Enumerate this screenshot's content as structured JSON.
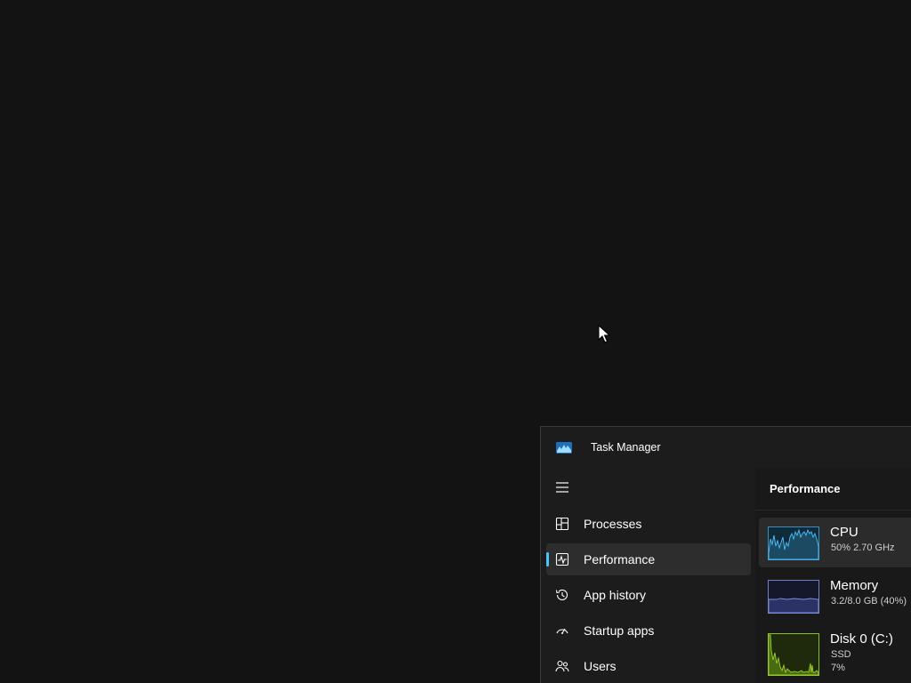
{
  "window": {
    "title": "Task Manager"
  },
  "nav": {
    "items": [
      {
        "label": "Processes",
        "icon": "processes-icon",
        "selected": false
      },
      {
        "label": "Performance",
        "icon": "performance-icon",
        "selected": true
      },
      {
        "label": "App history",
        "icon": "app-history-icon",
        "selected": false
      },
      {
        "label": "Startup apps",
        "icon": "startup-apps-icon",
        "selected": false
      },
      {
        "label": "Users",
        "icon": "users-icon",
        "selected": false
      }
    ]
  },
  "performance": {
    "title": "Performance",
    "resources": [
      {
        "name": "CPU",
        "details": [
          "50%  2.70 GHz"
        ],
        "color": "#4cc2ff",
        "selected": true
      },
      {
        "name": "Memory",
        "details": [
          "3.2/8.0 GB (40%)"
        ],
        "color": "#7d8fd6",
        "selected": false
      },
      {
        "name": "Disk 0 (C:)",
        "details": [
          "SSD",
          "7%"
        ],
        "color": "#9bd12a",
        "selected": false
      }
    ]
  },
  "colors": {
    "accent": "#4cc2ff",
    "background": "#131313",
    "window": "#1c1c1c"
  }
}
